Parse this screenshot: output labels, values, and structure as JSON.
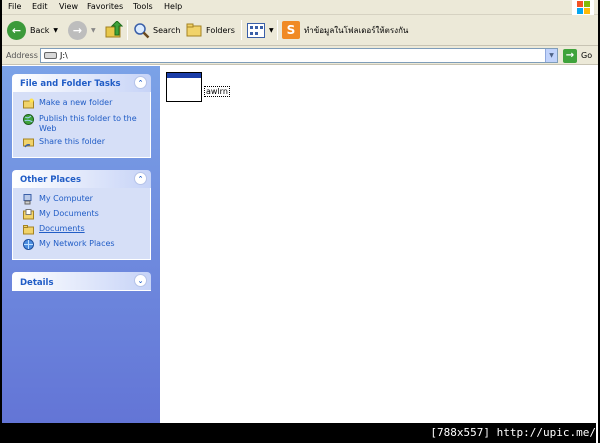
{
  "menu": {
    "items": [
      "File",
      "Edit",
      "View",
      "Favorites",
      "Tools",
      "Help"
    ]
  },
  "toolbar": {
    "back_label": "Back",
    "search_label": "Search",
    "folders_label": "Folders",
    "custom_label": "ทำข้อมูลในโฟลเดอร์ให้ตรงกัน"
  },
  "address": {
    "label": "Address",
    "value": "J:\\",
    "go_label": "Go"
  },
  "panels": {
    "file_tasks": {
      "title": "File and Folder Tasks",
      "items": [
        "Make a new folder",
        "Publish this folder to the Web",
        "Share this folder"
      ]
    },
    "other_places": {
      "title": "Other Places",
      "items": [
        "My Computer",
        "My Documents",
        "Documents",
        "My Network Places"
      ]
    },
    "details": {
      "title": "Details"
    }
  },
  "files": [
    {
      "name": "awlrn"
    }
  ],
  "watermark": "[788x557] http://upic.me/",
  "colors": {
    "menubar": "#ece9d8",
    "pane_gradient_top": "#7ba2e7",
    "pane_gradient_bottom": "#6375d6",
    "link": "#215dc6"
  }
}
